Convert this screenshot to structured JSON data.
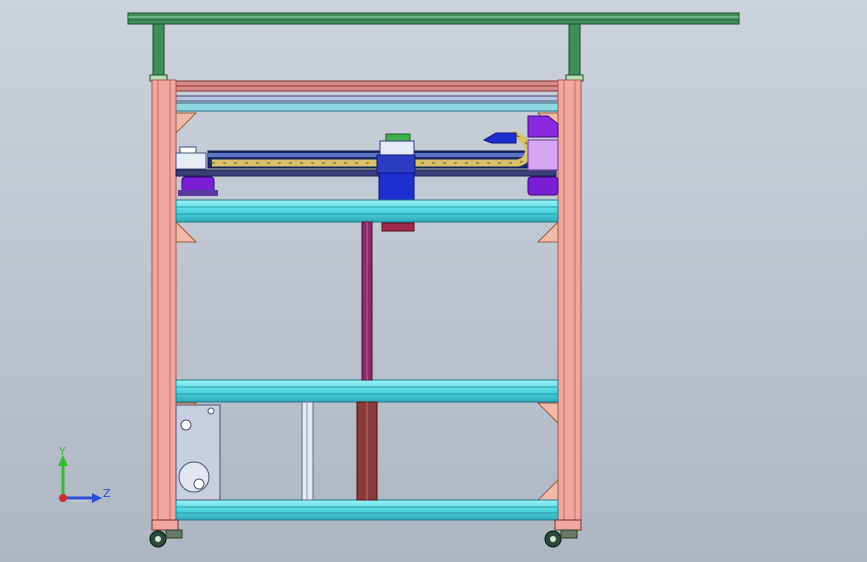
{
  "viewport": {
    "background_top": "#cdd3dc",
    "background_bottom": "#aeb6c3"
  },
  "triad": {
    "y_label": "Y",
    "z_label": "Z",
    "y_color": "#2fbf2f",
    "z_color": "#2a4fd6",
    "origin_color": "#d42a2a"
  },
  "colors": {
    "post": "#f0a7a0",
    "post_edge": "#b5524a",
    "crossbar_cyan": "#5ee0e8",
    "canopy_green": "#3f8f5a",
    "drive_blue": "#1d2fd0",
    "motor_purple": "#7a1fd6",
    "cable_chain": "#d8c26a",
    "panel_grey": "#c9cfe0",
    "rail_maroon": "#8a2a4a"
  }
}
